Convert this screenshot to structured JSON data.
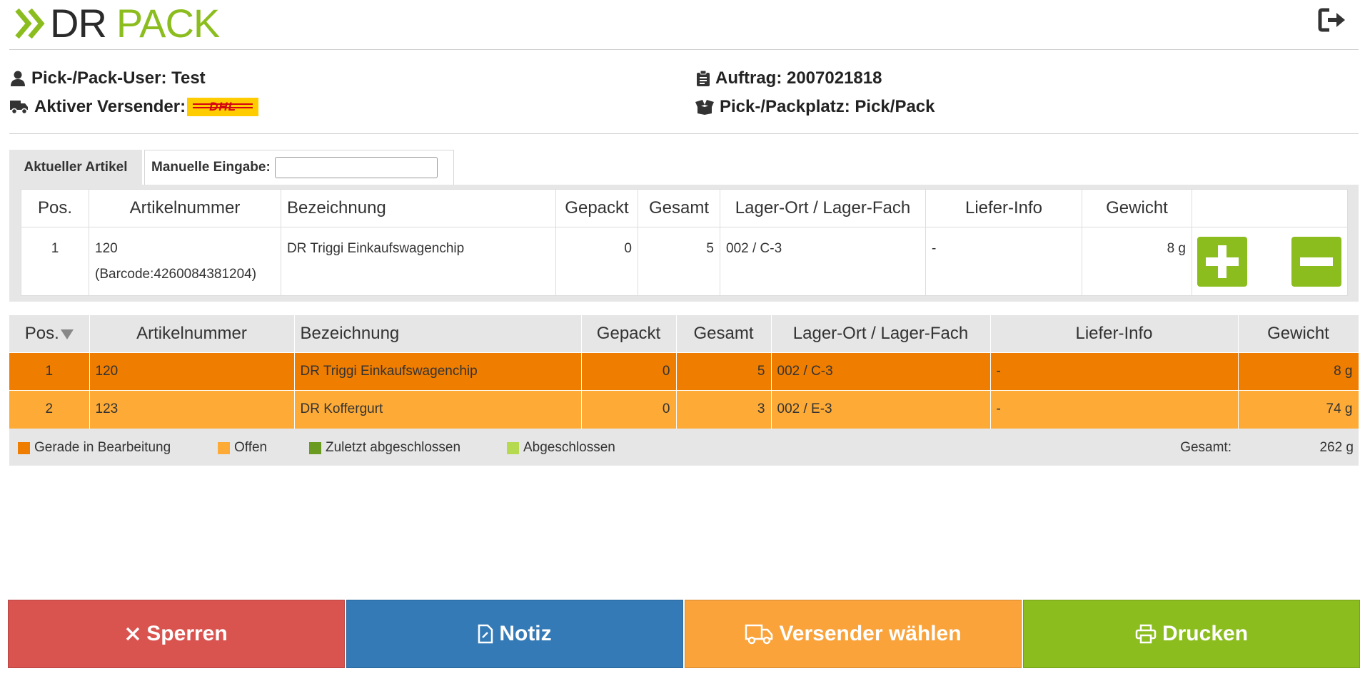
{
  "header": {
    "logo_dr": "DR",
    "logo_pack": "PACK",
    "logout_icon": "sign-out-icon"
  },
  "info": {
    "user_label": "Pick-/Pack-User: Test",
    "shipper_label": "Aktiver Versender:",
    "shipper_logo_text": "DHL",
    "order_label": "Auftrag: 2007021818",
    "station_label": "Pick-/Packplatz: Pick/Pack"
  },
  "tabs": {
    "current": "Aktueller Artikel",
    "manual_label": "Manuelle Eingabe:",
    "manual_value": ""
  },
  "current_table": {
    "headers": [
      "Pos.",
      "Artikelnummer",
      "Bezeichnung",
      "Gepackt",
      "Gesamt",
      "Lager-Ort / Lager-Fach",
      "Liefer-Info",
      "Gewicht",
      ""
    ],
    "row": {
      "pos": "1",
      "artnr": "120",
      "barcode": "(Barcode:4260084381204)",
      "name": "DR Triggi Einkaufswagenchip",
      "packed": "0",
      "total": "5",
      "location": "002 / C-3",
      "info": "-",
      "weight": "8 g"
    }
  },
  "list_table": {
    "headers": [
      "Pos.",
      "Artikelnummer",
      "Bezeichnung",
      "Gepackt",
      "Gesamt",
      "Lager-Ort / Lager-Fach",
      "Liefer-Info",
      "Gewicht"
    ],
    "rows": [
      {
        "pos": "1",
        "artnr": "120",
        "name": "DR Triggi Einkaufswagenchip",
        "packed": "0",
        "total": "5",
        "location": "002 / C-3",
        "info": "-",
        "weight": "8 g",
        "state": "active"
      },
      {
        "pos": "2",
        "artnr": "123",
        "name": "DR Koffergurt",
        "packed": "0",
        "total": "3",
        "location": "002 / E-3",
        "info": "-",
        "weight": "74 g",
        "state": "open"
      }
    ]
  },
  "legend": {
    "items": [
      {
        "label": "Gerade in Bearbeitung",
        "color": "#ef7d00"
      },
      {
        "label": "Offen",
        "color": "#fdab36"
      },
      {
        "label": "Zuletzt abgeschlossen",
        "color": "#6a9a1f"
      },
      {
        "label": "Abgeschlossen",
        "color": "#b5d94f"
      }
    ],
    "total_label": "Gesamt:",
    "total_value": "262 g"
  },
  "buttons": {
    "lock": "Sperren",
    "note": "Notiz",
    "shipper": "Versender wählen",
    "print": "Drucken"
  },
  "colors": {
    "brand_green": "#8bbd1e",
    "lock_red": "#d9534f",
    "note_blue": "#337ab7",
    "shipper_orange": "#f9a33a",
    "print_green": "#8bbd1e"
  }
}
